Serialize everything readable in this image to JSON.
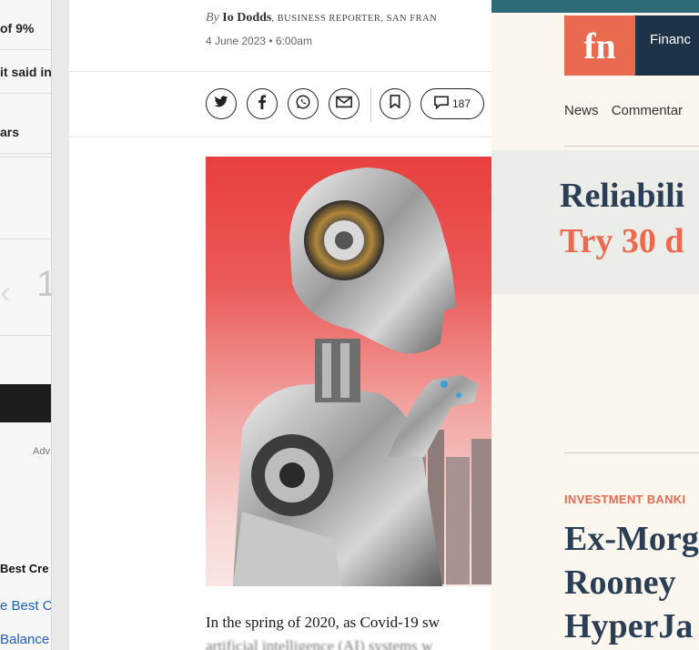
{
  "left_window": {
    "rows": [
      "of 9%",
      "it said in",
      "ars"
    ],
    "stat_partial": "1",
    "ad_label": "Adv",
    "bold_text": "Best Cre",
    "links": [
      "e Best C",
      "Balance"
    ]
  },
  "article": {
    "byline_prefix": "By",
    "author": "Io Dodds",
    "author_role": ", BUSINESS REPORTER, SAN FRAN",
    "date": "4 June 2023 • 6:00am",
    "share": {
      "twitter": "twitter-icon",
      "facebook": "facebook-icon",
      "whatsapp": "whatsapp-icon",
      "email": "email-icon",
      "bookmark": "bookmark-icon",
      "comment_count": "187"
    },
    "lead_paragraph": "In the spring of 2020, as Covid-19 sw",
    "lead_paragraph_next": "artificial intelligence (AI) systems w"
  },
  "right_window": {
    "logo": "fn",
    "brand_partial": "Financ",
    "nav": [
      "News",
      "Commentar"
    ],
    "promo_line1": "Reliabili",
    "promo_line2": "Try 30 d",
    "kicker": "INVESTMENT BANKI",
    "headline": [
      "Ex-Morg",
      "Rooney",
      "HyperJa"
    ],
    "colors": {
      "accent": "#ea6a4f",
      "navy": "#1f3348",
      "teal": "#2f6b76"
    }
  }
}
